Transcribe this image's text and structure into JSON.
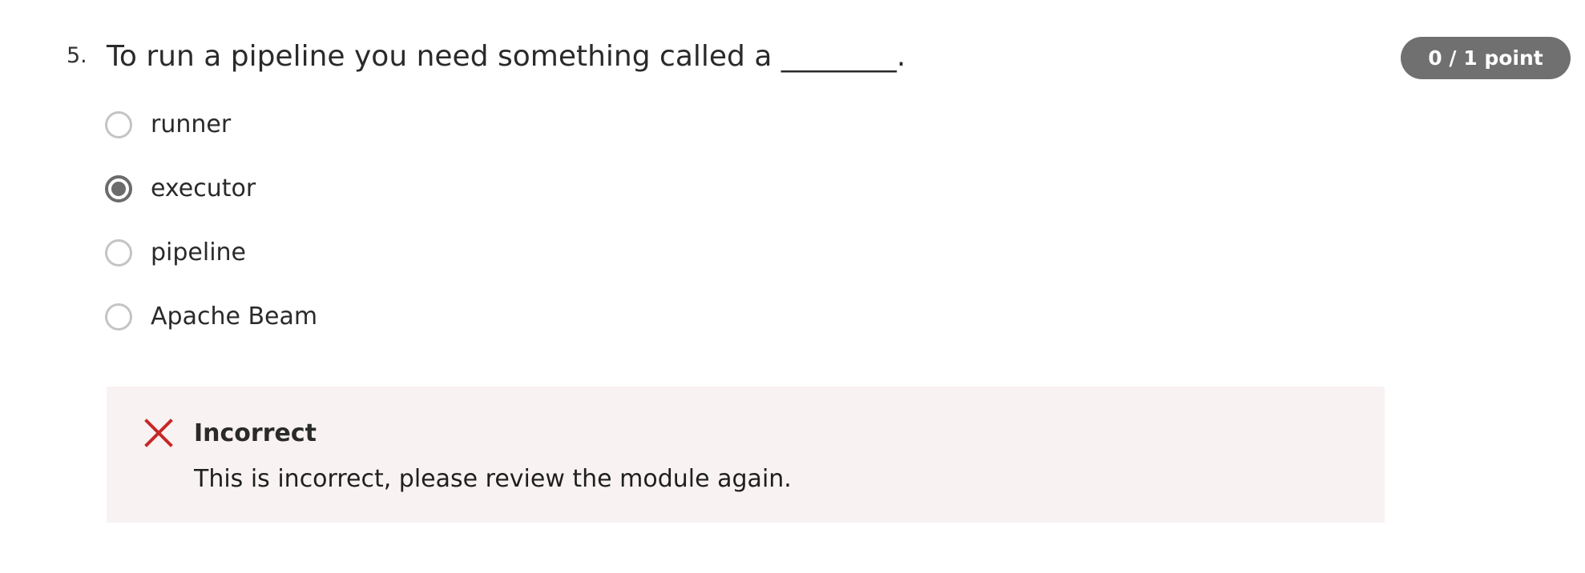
{
  "question": {
    "number": "5.",
    "text": "To run a pipeline you need something called a ________.",
    "score": "0 / 1 point"
  },
  "options": [
    {
      "label": "runner",
      "selected": false
    },
    {
      "label": "executor",
      "selected": true
    },
    {
      "label": "pipeline",
      "selected": false
    },
    {
      "label": "Apache Beam",
      "selected": false
    }
  ],
  "feedback": {
    "icon": "close-icon",
    "title": "Incorrect",
    "message": "This is incorrect, please review the module again.",
    "icon_color": "#c62828",
    "background_color": "#f9f2f2"
  },
  "colors": {
    "badge": "#707070",
    "radio_selected": "#6b6b6b",
    "radio_unselected": "#c4c4c4"
  }
}
